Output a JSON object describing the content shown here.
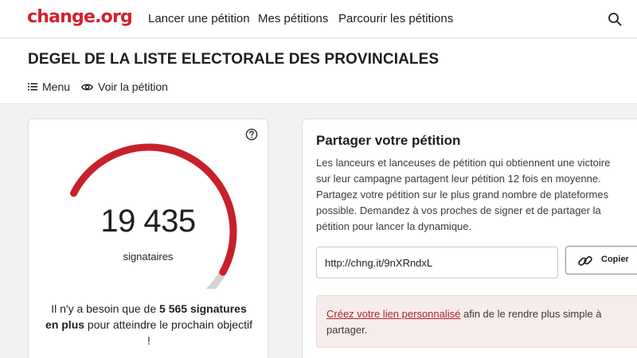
{
  "brand": {
    "logo_text": "change.org",
    "accent_color": "#d3212c"
  },
  "nav": {
    "start": "Lancer une pétition",
    "mine": "Mes pétitions",
    "browse": "Parcourir les pétitions",
    "search_icon": "search-icon"
  },
  "petition": {
    "title": "DEGEL DE LA LISTE ELECTORALE DES PROVINCIALES",
    "menu_label": "Menu",
    "view_label": "Voir la pétition"
  },
  "signatures": {
    "count": "19 435",
    "label": "signataires",
    "progress_fraction": 0.777,
    "need_prefix": "Il n'y a besoin que de ",
    "need_bold": "5 565 signatures en plus",
    "need_suffix": " pour atteindre le prochain objectif !",
    "help_icon": "question-circle-icon"
  },
  "share": {
    "title": "Partager votre pétition",
    "description": "Les lanceurs et lanceuses de pétition qui obtiennent une victoire sur leur campagne partagent leur pétition 12 fois en moyenne. Partagez votre pétition sur le plus grand nombre de plateformes possible. Demandez à vos proches de signer et de partager la pétition pour lancer la dynamique.",
    "link_value": "http://chng.it/9nXRndxL",
    "copy_label": "Copier",
    "copy_icon": "link-icon",
    "promo_link": "Créez votre lien personnalisé",
    "promo_text": " afin de le rendre plus simple à partager."
  }
}
